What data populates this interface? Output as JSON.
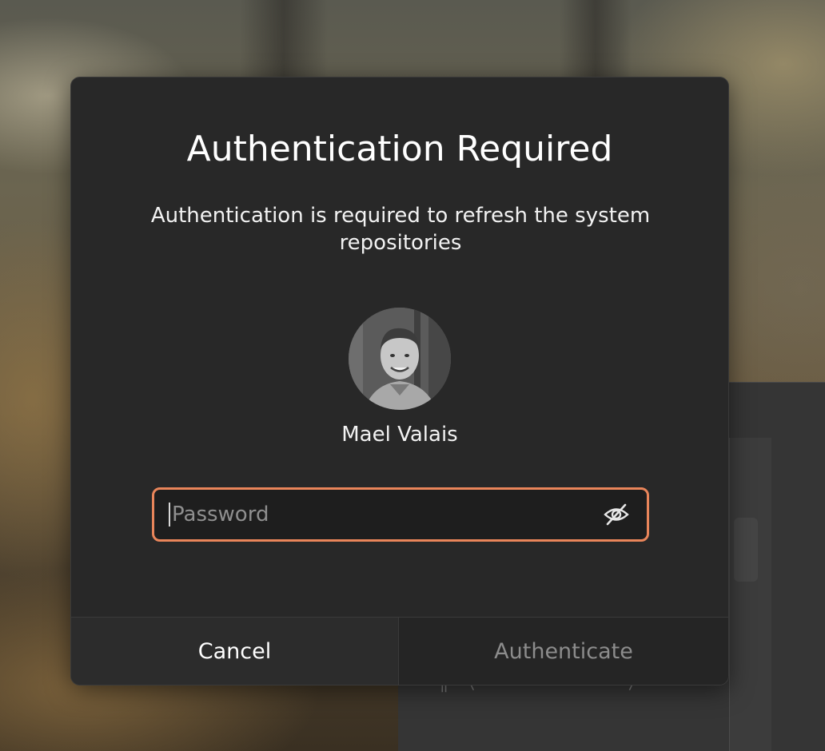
{
  "dialog": {
    "title": "Authentication Required",
    "message": "Authentication is required to refresh the system repositories",
    "user": {
      "name": "Mael Valais",
      "avatar": "user-photo"
    },
    "password": {
      "placeholder": "Password",
      "value": "",
      "reveal_icon": "eye-slash-icon"
    },
    "buttons": {
      "cancel_label": "Cancel",
      "authenticate_label": "Authenticate"
    }
  },
  "colors": {
    "focus_border": "#e9855a",
    "dialog_background": "#282828",
    "disabled_text": "#8c8c8c"
  }
}
